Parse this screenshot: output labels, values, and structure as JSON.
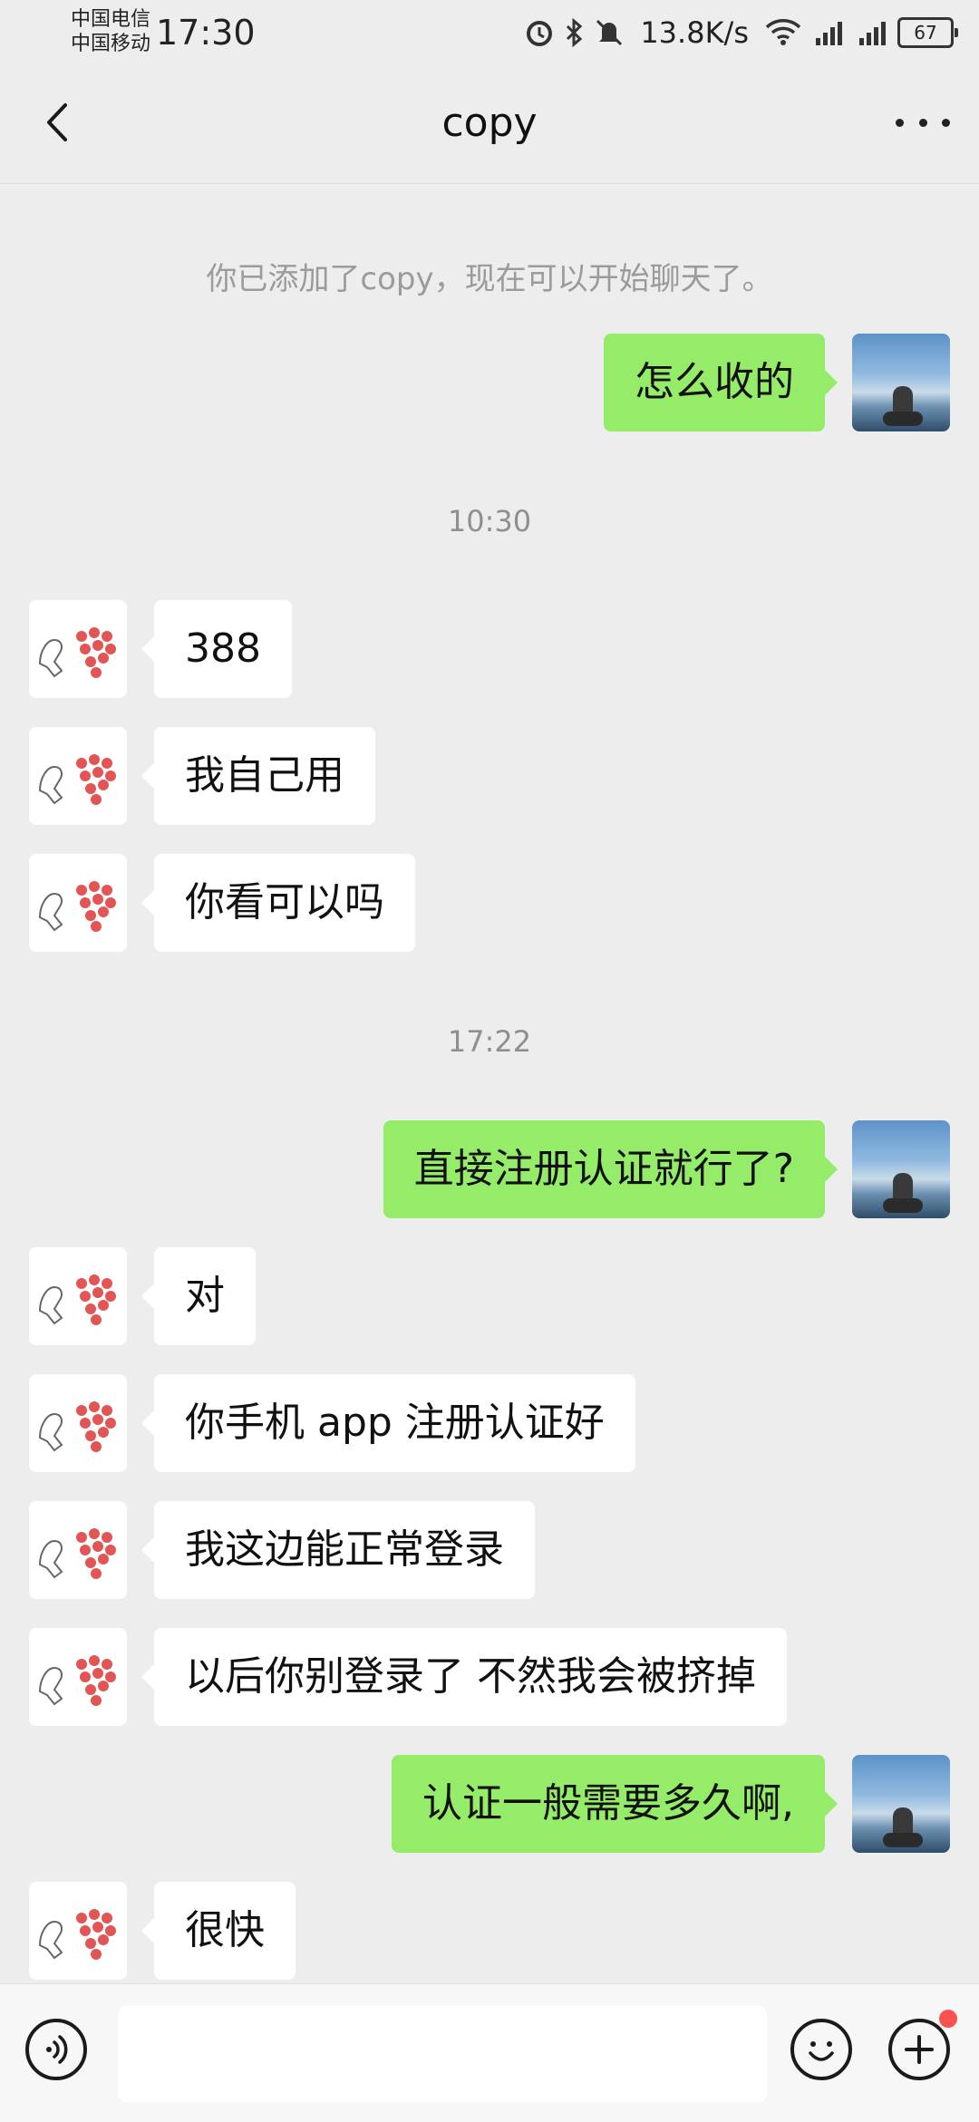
{
  "status_bar": {
    "carrier1": "中国电信",
    "carrier2": "中国移动",
    "time": "17:30",
    "net_speed": "13.8K/s",
    "battery": "67",
    "icons": [
      "alarm-icon",
      "bluetooth-icon",
      "mute-icon",
      "wifi-icon",
      "signal-4g-icon",
      "signal-4g-icon",
      "battery-icon"
    ]
  },
  "header": {
    "title": "copy",
    "back_icon": "chevron-left-icon",
    "more_icon": "more-dots-icon"
  },
  "chat": {
    "system_notice": "你已添加了copy，现在可以开始聊天了。",
    "messages": [
      {
        "sender": "me",
        "text": "怎么收的"
      },
      {
        "type": "time",
        "text": "10:30"
      },
      {
        "sender": "other",
        "text": "388"
      },
      {
        "sender": "other",
        "text": "我自己用"
      },
      {
        "sender": "other",
        "text": "你看可以吗"
      },
      {
        "type": "time",
        "text": "17:22"
      },
      {
        "sender": "me",
        "text": "直接注册认证就行了?"
      },
      {
        "sender": "other",
        "text": "对"
      },
      {
        "sender": "other",
        "text": "你手机 app 注册认证好"
      },
      {
        "sender": "other",
        "text": "我这边能正常登录"
      },
      {
        "sender": "other",
        "text": "以后你别登录了 不然我会被挤掉"
      },
      {
        "sender": "me",
        "text": "认证一般需要多久啊,"
      },
      {
        "sender": "other",
        "text": "很快"
      }
    ]
  },
  "input_bar": {
    "voice_icon": "voice-icon",
    "input_value": "",
    "emoji_icon": "emoji-icon",
    "plus_icon": "plus-icon"
  },
  "colors": {
    "my_bubble": "#95ec69",
    "other_bubble": "#ffffff",
    "background": "#ededed",
    "badge": "#fa5151"
  }
}
